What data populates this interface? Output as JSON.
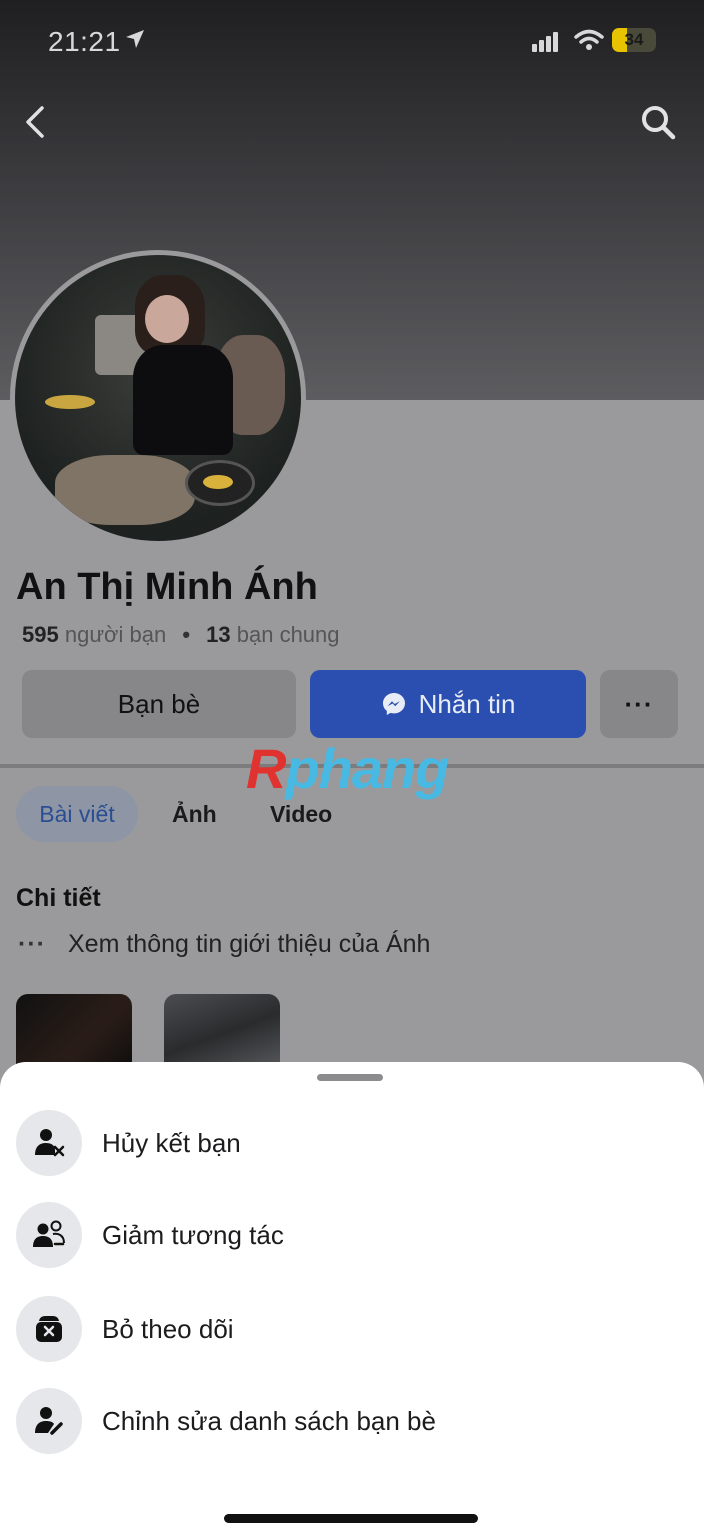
{
  "status_bar": {
    "time": "21:21",
    "battery": "34",
    "battery_level": 0.34
  },
  "icons": {
    "back": "chevron-left-icon",
    "search": "search-icon",
    "location": "location-arrow-icon",
    "signal": "signal-icon",
    "wifi": "wifi-icon",
    "battery": "battery-icon",
    "messenger": "messenger-icon"
  },
  "profile": {
    "name": "An Thị Minh Ánh",
    "friends_count": "595",
    "friends_label": "người bạn",
    "mutual_count": "13",
    "mutual_label": "bạn chung"
  },
  "actions": {
    "friends": "Bạn bè",
    "message": "Nhắn tin",
    "more": "···"
  },
  "watermark": {
    "first": "R",
    "rest": "phang"
  },
  "tabs": [
    {
      "label": "Bài viết",
      "active": true
    },
    {
      "label": "Ảnh",
      "active": false
    },
    {
      "label": "Video",
      "active": false
    }
  ],
  "details": {
    "title": "Chi tiết",
    "dots": "···",
    "intro": "Xem thông tin giới thiệu của Ánh"
  },
  "sheet": {
    "items": [
      {
        "label": "Hủy kết bạn",
        "icon": "unfriend-icon"
      },
      {
        "label": "Giảm tương tác",
        "icon": "reduce-interaction-icon"
      },
      {
        "label": "Bỏ theo dõi",
        "icon": "unfollow-icon"
      },
      {
        "label": "Chỉnh sửa danh sách bạn bè",
        "icon": "edit-friend-list-icon"
      }
    ]
  },
  "colors": {
    "primary": "#2a4fb0",
    "watermark_red": "#e0322e",
    "watermark_blue": "#47b9e3"
  }
}
